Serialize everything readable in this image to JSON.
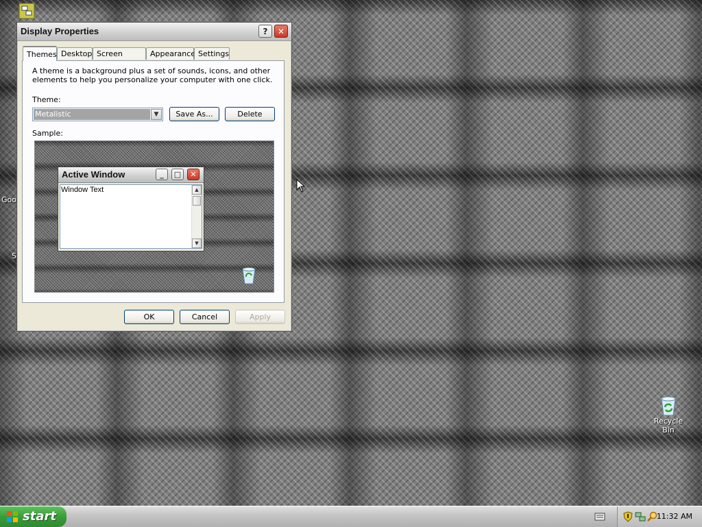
{
  "desktop": {
    "recycle_bin_label": "Recycle Bin",
    "left_partial_labels": [
      "Goo",
      "S"
    ]
  },
  "dialog": {
    "title": "Display Properties",
    "help_glyph": "?",
    "close_glyph": "✕",
    "tabs": [
      "Themes",
      "Desktop",
      "Screen Saver",
      "Appearance",
      "Settings"
    ],
    "active_tab": "Themes",
    "description": "A theme is a background plus a set of sounds, icons, and other elements to help you personalize your computer with one click.",
    "theme_label": "Theme:",
    "theme_value": "Metalistic",
    "save_as_label": "Save As...",
    "delete_label": "Delete",
    "sample_label": "Sample:",
    "preview": {
      "window_title": "Active Window",
      "window_text": "Window Text"
    },
    "ok_label": "OK",
    "cancel_label": "Cancel",
    "apply_label": "Apply"
  },
  "taskbar": {
    "start_label": "start",
    "clock": "11:32 AM"
  },
  "colors": {
    "start_green": "#3a9c3a",
    "close_red": "#c93a26",
    "selection_gray": "#a4a4a4"
  }
}
